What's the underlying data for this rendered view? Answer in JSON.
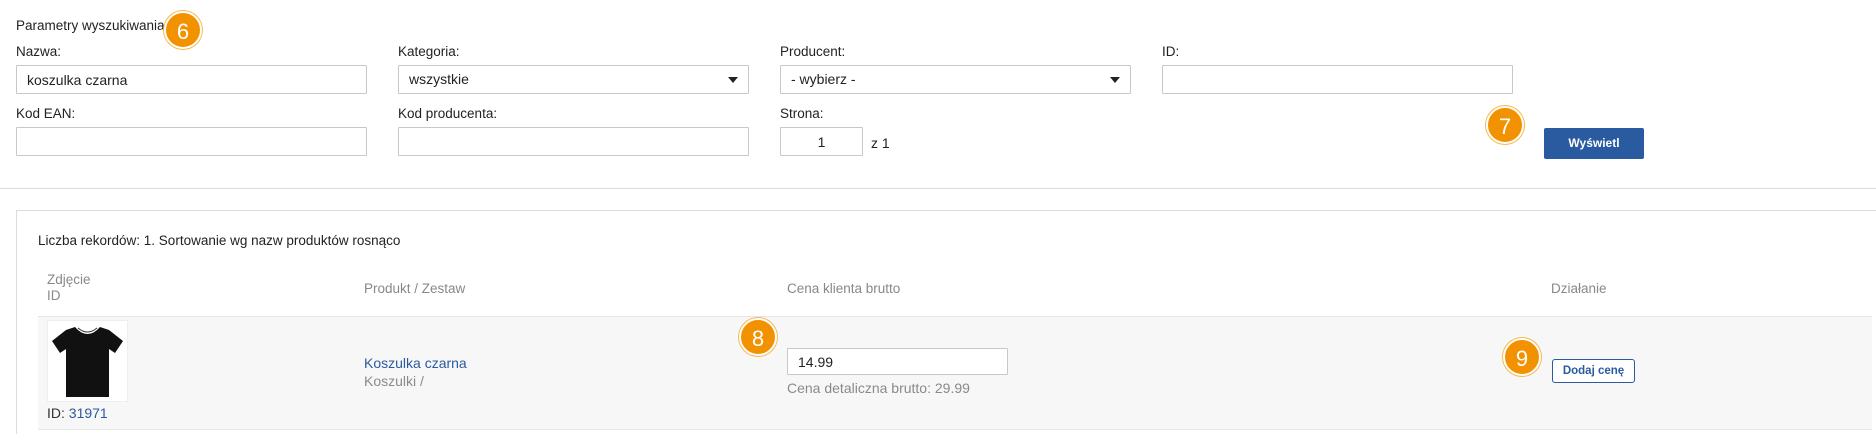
{
  "search": {
    "title": "Parametry wyszukiwania",
    "nazwa_label": "Nazwa:",
    "nazwa_value": "koszulka czarna",
    "kategoria_label": "Kategoria:",
    "kategoria_value": "wszystkie",
    "producent_label": "Producent:",
    "producent_value": "- wybierz -",
    "id_label": "ID:",
    "id_value": "",
    "ean_label": "Kod EAN:",
    "ean_value": "",
    "kod_producenta_label": "Kod producenta:",
    "kod_producenta_value": "",
    "strona_label": "Strona:",
    "strona_value": "1",
    "strona_total": "z 1",
    "show_button": "Wyświetl"
  },
  "badges": [
    "6",
    "7",
    "8",
    "9"
  ],
  "results": {
    "summary": "Liczba rekordów: 1. Sortowanie wg nazw produktów rosnąco",
    "columns": {
      "photo_line1": "Zdjęcie",
      "photo_line2": "ID",
      "product": "Produkt / Zestaw",
      "price": "Cena klienta brutto",
      "action": "Działanie"
    },
    "rows": [
      {
        "id_label": "ID:",
        "id": "31971",
        "product_name": "Koszulka czarna",
        "product_category": "Koszulki /",
        "price_value": "14.99",
        "retail_price": "Cena detaliczna brutto: 29.99",
        "action_button": "Dodaj cenę"
      }
    ]
  },
  "colors": {
    "accent": "#2a5aa0",
    "badge": "#f39200"
  },
  "icons": [
    "tshirt-icon",
    "caret-down-icon"
  ]
}
